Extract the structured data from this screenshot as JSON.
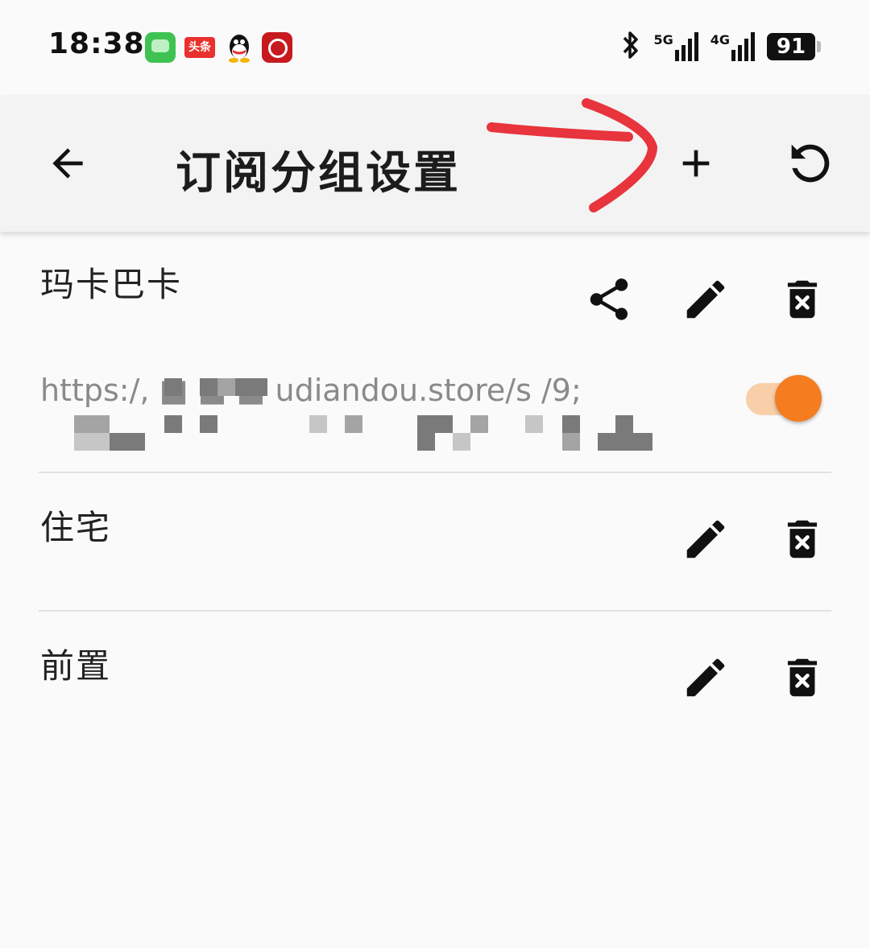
{
  "status_bar": {
    "time": "18:38",
    "notification_app_label": "头条",
    "net1_label": "5G",
    "net2_label": "4G",
    "battery": "91",
    "icons": [
      "messages-app-icon",
      "toutiao-app-icon",
      "qq-app-icon",
      "bank-app-icon",
      "bluetooth-icon",
      "signal-5g-icon",
      "signal-4g-icon",
      "battery-icon"
    ]
  },
  "toolbar": {
    "title": "订阅分组设置",
    "icons": [
      "back-arrow-icon",
      "add-icon",
      "restore-icon"
    ]
  },
  "groups": [
    {
      "name": "玛卡巴卡",
      "url": "https:/,  ■  ■ ■ udiandou.store/s /9; ",
      "enabled": true,
      "icons": [
        "share-icon",
        "edit-icon",
        "delete-icon"
      ]
    },
    {
      "name": "住宅",
      "icons": [
        "edit-icon",
        "delete-icon"
      ]
    },
    {
      "name": "前置",
      "icons": [
        "edit-icon",
        "delete-icon"
      ]
    }
  ],
  "colors": {
    "accent": "#f57c1f",
    "toggle_track": "#f9cfa9",
    "annotation": "#e8343c",
    "background": "#fafafa",
    "toolbar": "#f3f3f3"
  }
}
